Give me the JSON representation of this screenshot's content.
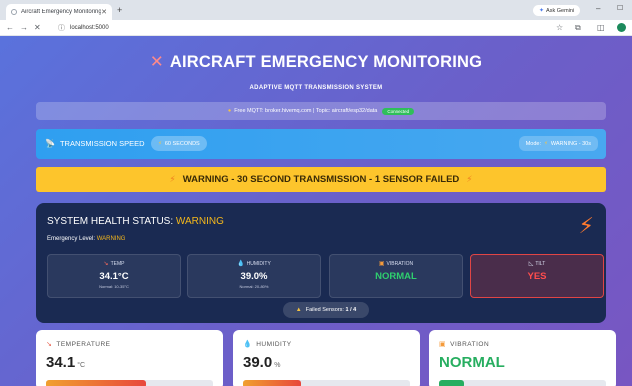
{
  "browser": {
    "tab_title": "Aircraft Emergency Monitoring",
    "tab_close": "✕",
    "new_tab": "+",
    "gemini_label": "Ask Gemini",
    "min_glyph": "–",
    "max_glyph": "☐",
    "url": "localhost:5000",
    "nav_back": "←",
    "nav_forward": "→",
    "nav_reload": "✕",
    "icons": [
      "star-icon",
      "extensions-icon",
      "split-icon",
      "profile-icon"
    ]
  },
  "header": {
    "title": "AIRCRAFT EMERGENCY MONITORING",
    "icon": "✕",
    "subtitle": "ADAPTIVE MQTT TRANSMISSION SYSTEM"
  },
  "mqtt": {
    "text": "Free MQTT: broker.hivemq.com | Topic: aircraft/esp32/data",
    "status": "Connected",
    "status_color": "#2fbf5a"
  },
  "speed": {
    "label": "TRANSMISSION SPEED",
    "value": "60 SECONDS",
    "mode_prefix": "Mode:",
    "mode_value": "WARNING - 30s"
  },
  "warning_banner": {
    "text": "WARNING - 30 SECOND TRANSMISSION - 1 SENSOR FAILED",
    "color": "#fdc52c"
  },
  "health": {
    "title_prefix": "SYSTEM HEALTH STATUS:",
    "title_status": "WARNING",
    "level_prefix": "Emergency Level:",
    "level_value": "WARNING",
    "sensors": [
      {
        "label": "TEMP",
        "icon": "thermometer-icon",
        "value": "34.1°C",
        "normal": "Normal: 10-35°C"
      },
      {
        "label": "HUMIDITY",
        "icon": "droplet-icon",
        "value": "39.0%",
        "normal": "Normal: 20-80%"
      },
      {
        "label": "VIBRATION",
        "icon": "vibration-icon",
        "value": "NORMAL",
        "normal": ""
      },
      {
        "label": "TILT",
        "icon": "tilt-icon",
        "value": "YES",
        "normal": ""
      }
    ],
    "failed_label": "Failed Sensors:",
    "failed_value": "1 / 4"
  },
  "cards": [
    {
      "label": "TEMPERATURE",
      "icon": "thermometer-icon",
      "value": "34.1",
      "unit": "°C",
      "bar_fraction": 0.6
    },
    {
      "label": "HUMIDITY",
      "icon": "droplet-icon",
      "value": "39.0",
      "unit": "%",
      "bar_fraction": 0.35
    },
    {
      "label": "VIBRATION",
      "icon": "vibration-icon",
      "value": "NORMAL",
      "unit": "",
      "bar_fraction": 0.15
    }
  ],
  "colors": {
    "warning": "#f5b81b",
    "danger": "#ff4d4d",
    "ok": "#2fcf6e"
  }
}
